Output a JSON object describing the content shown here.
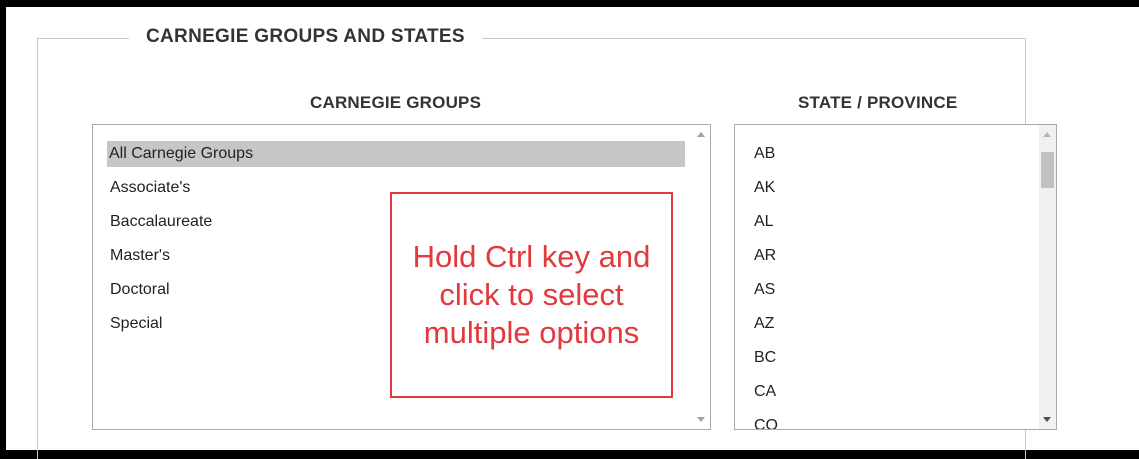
{
  "section": {
    "title": "CARNEGIE GROUPS AND STATES"
  },
  "carnegie_groups": {
    "label": "CARNEGIE GROUPS",
    "options": [
      "All Carnegie Groups",
      "Associate's",
      "Baccalaureate",
      "Master's",
      "Doctoral",
      "Special"
    ],
    "selected": "All Carnegie Groups"
  },
  "state_province": {
    "label": "STATE / PROVINCE",
    "options": [
      "AB",
      "AK",
      "AL",
      "AR",
      "AS",
      "AZ",
      "BC",
      "CA",
      "CO"
    ]
  },
  "callout": {
    "text": "Hold Ctrl key and click to select multiple options",
    "color": "#e2393c"
  }
}
